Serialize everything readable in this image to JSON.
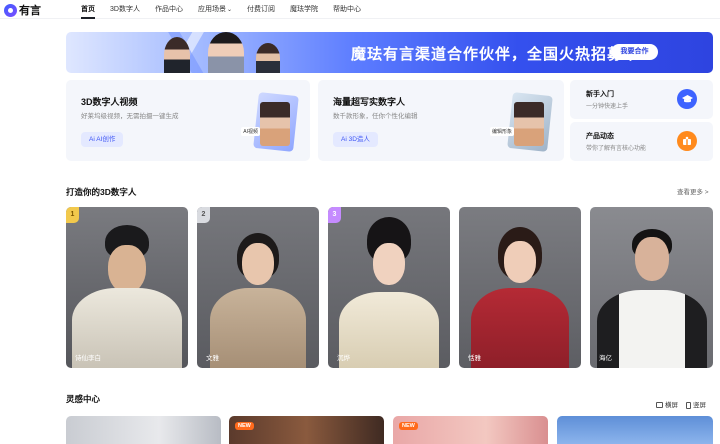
{
  "brand": {
    "logo_text": "有言"
  },
  "nav": {
    "items": [
      {
        "label": "首页",
        "active": true
      },
      {
        "label": "3D数字人"
      },
      {
        "label": "作品中心"
      },
      {
        "label": "应用场景",
        "has_dropdown": true
      },
      {
        "label": "付费订阅"
      },
      {
        "label": "魔珐学院"
      },
      {
        "label": "帮助中心"
      }
    ]
  },
  "banner": {
    "title": "魔珐有言渠道合作伙伴，全国火热招募中",
    "button": "我要合作",
    "colors": {
      "from": "#dfe7ff",
      "to": "#2e44e0"
    }
  },
  "features": [
    {
      "title": "3D数字人视频",
      "subtitle": "好莱坞级视频，无需拍摄一键生成",
      "button": "Ai AI创作",
      "tag": "AI视频"
    },
    {
      "title": "海量超写实数字人",
      "subtitle": "数千款形象，任你个性化编辑",
      "button": "Ai 3D造人",
      "tag": "编辑形象"
    }
  ],
  "side_cards": [
    {
      "title": "新手入门",
      "subtitle": "一分钟快速上手",
      "icon": "graduation-cap-icon"
    },
    {
      "title": "产品动态",
      "subtitle": "带你了解有言核心功能",
      "icon": "gift-box-icon"
    }
  ],
  "avatar_section": {
    "title": "打造你的3D数字人",
    "see_more": "查看更多 >",
    "avatars": [
      {
        "rank": "1",
        "name": "诗仙李白"
      },
      {
        "rank": "2",
        "name": "文雅"
      },
      {
        "rank": "3",
        "name": "沉烨"
      },
      {
        "rank": "",
        "name": "恬雅"
      },
      {
        "rank": "",
        "name": "海亿"
      }
    ]
  },
  "inspiration": {
    "title": "灵感中心",
    "view_options": [
      "横屏",
      "竖屏"
    ],
    "thumbs": [
      {
        "badge": ""
      },
      {
        "badge": "NEW"
      },
      {
        "badge": "NEW"
      },
      {
        "badge": ""
      }
    ]
  },
  "colors": {
    "accent": "#3c54f5",
    "orange": "#ff8a1c"
  }
}
